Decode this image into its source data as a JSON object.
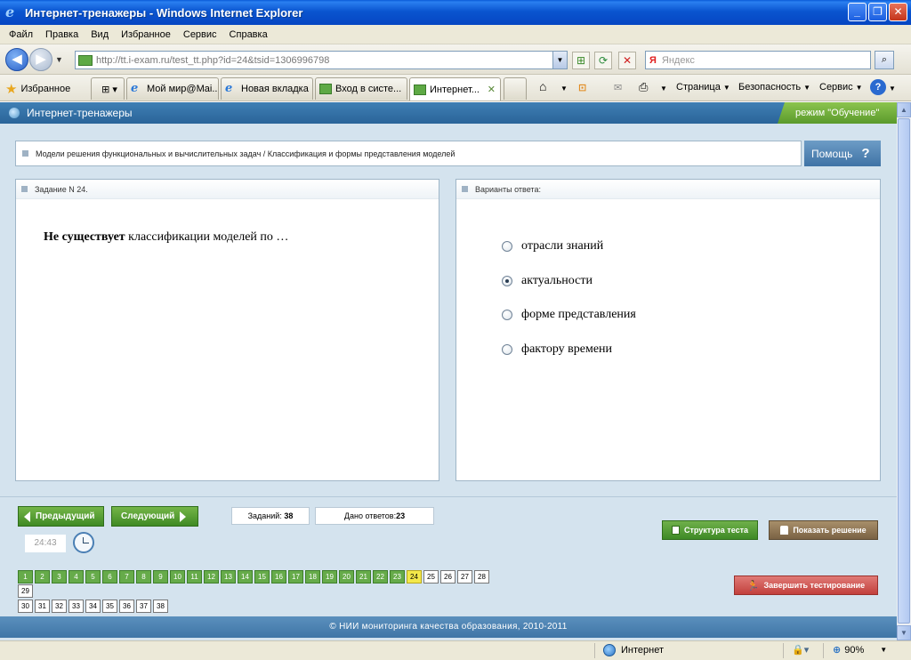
{
  "window": {
    "title": "Интернет-тренажеры - Windows Internet Explorer",
    "min_glyph": "_",
    "max_glyph": "❐",
    "close_glyph": "✕"
  },
  "menu": [
    "Файл",
    "Правка",
    "Вид",
    "Избранное",
    "Сервис",
    "Справка"
  ],
  "address": {
    "url": "http://tt.i-exam.ru/test_tt.php?id=24&tsid=1306996798",
    "search_placeholder": "Яндекс",
    "search_logo": "Я"
  },
  "favorites": {
    "label": "Избранное",
    "tabs": [
      {
        "title": "Мой мир@Mai...",
        "icon": "ie-icon"
      },
      {
        "title": "Новая вкладка",
        "icon": "ie-icon"
      },
      {
        "title": "Вход в систе...",
        "icon": "page-icon"
      },
      {
        "title": "Интернет...",
        "icon": "page-icon",
        "active": true
      }
    ],
    "commands": {
      "page": "Страница",
      "security": "Безопасность",
      "tools": "Сервис"
    }
  },
  "app": {
    "title": "Интернет-тренажеры",
    "mode": "режим \"Обучение\"",
    "breadcrumb": "Модели решения функциональных и вычислительных задач / Классификация и формы представления моделей",
    "help_label": "Помощь",
    "help_glyph": "?",
    "task_header": "Задание N 24.",
    "question_bold": "Не существует",
    "question_rest": " классификации моделей по …",
    "answers_header": "Варианты ответа:",
    "answers": [
      {
        "text": "отрасли знаний",
        "checked": false
      },
      {
        "text": "актуальности",
        "checked": true
      },
      {
        "text": "форме представления",
        "checked": false
      },
      {
        "text": "фактору времени",
        "checked": false
      }
    ],
    "prev_label": "Предыдущий",
    "next_label": "Следующий",
    "tasks_label": "Заданий:",
    "tasks_count": "38",
    "answered_label": "Дано ответов:",
    "answered_count": "23",
    "timer": "24:43",
    "structure_label": "Структура теста",
    "show_solution_label": "Показать решение",
    "finish_label": "Завершить тестирование",
    "questions": {
      "total": 38,
      "answered_through": 23,
      "current": 24
    },
    "footer": "© НИИ мониторинга качества образования, 2010-2011"
  },
  "status": {
    "zone": "Интернет",
    "zoom": "90%"
  }
}
